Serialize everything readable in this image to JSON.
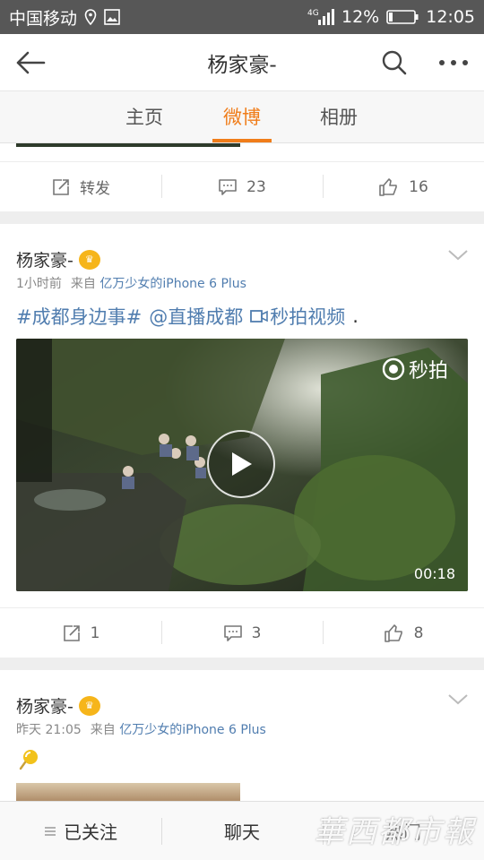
{
  "status_bar": {
    "carrier": "中国移动",
    "network": "4G",
    "battery": "12%",
    "time": "12:05"
  },
  "nav": {
    "title": "杨家豪-"
  },
  "tabs": [
    {
      "label": "主页",
      "active": false
    },
    {
      "label": "微博",
      "active": true
    },
    {
      "label": "相册",
      "active": false
    }
  ],
  "post0": {
    "repost_label": "转发",
    "comments": "23",
    "likes": "16"
  },
  "post1": {
    "username": "杨家豪-",
    "time": "1小时前",
    "source_prefix": "来自",
    "source": "亿万少女的iPhone 6 Plus",
    "topic": "#成都身边事#",
    "mention": "@直播成都",
    "video_link": "秒拍视频",
    "text_end": ".",
    "video_logo": "秒拍",
    "duration": "00:18",
    "reposts": "1",
    "comments": "3",
    "likes": "8"
  },
  "post2": {
    "username": "杨家豪-",
    "time": "昨天 21:05",
    "source_prefix": "来自",
    "source": "亿万少女的iPhone 6 Plus"
  },
  "bottom_bar": {
    "follow_label": "已关注",
    "chat_label": "聊天",
    "third_label": "热门"
  },
  "watermark": "華西都市報",
  "colors": {
    "accent": "#f07d1a",
    "link": "#507daf",
    "status_bar": "#575757"
  }
}
